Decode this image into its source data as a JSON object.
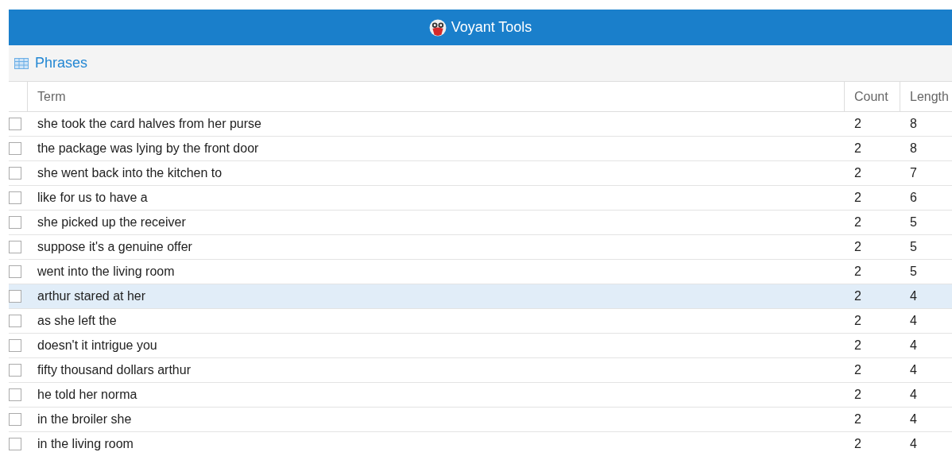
{
  "app_title": "Voyant Tools",
  "panel": {
    "title": "Phrases"
  },
  "table": {
    "columns": [
      "Term",
      "Count",
      "Length"
    ],
    "rows": [
      {
        "term": "she took the card halves from her purse",
        "count": "2",
        "length": "8",
        "checked": false,
        "selected": false
      },
      {
        "term": "the package was lying by the front door",
        "count": "2",
        "length": "8",
        "checked": false,
        "selected": false
      },
      {
        "term": "she went back into the kitchen to",
        "count": "2",
        "length": "7",
        "checked": false,
        "selected": false
      },
      {
        "term": "like for us to have a",
        "count": "2",
        "length": "6",
        "checked": false,
        "selected": false
      },
      {
        "term": "she picked up the receiver",
        "count": "2",
        "length": "5",
        "checked": false,
        "selected": false
      },
      {
        "term": "suppose it's a genuine offer",
        "count": "2",
        "length": "5",
        "checked": false,
        "selected": false
      },
      {
        "term": "went into the living room",
        "count": "2",
        "length": "5",
        "checked": false,
        "selected": false
      },
      {
        "term": "arthur stared at her",
        "count": "2",
        "length": "4",
        "checked": false,
        "selected": true
      },
      {
        "term": "as she left the",
        "count": "2",
        "length": "4",
        "checked": false,
        "selected": false
      },
      {
        "term": "doesn't it intrigue you",
        "count": "2",
        "length": "4",
        "checked": false,
        "selected": false
      },
      {
        "term": "fifty thousand dollars arthur",
        "count": "2",
        "length": "4",
        "checked": false,
        "selected": false
      },
      {
        "term": "he told her norma",
        "count": "2",
        "length": "4",
        "checked": false,
        "selected": false
      },
      {
        "term": "in the broiler she",
        "count": "2",
        "length": "4",
        "checked": false,
        "selected": false
      },
      {
        "term": "in the living room",
        "count": "2",
        "length": "4",
        "checked": false,
        "selected": false
      }
    ]
  }
}
